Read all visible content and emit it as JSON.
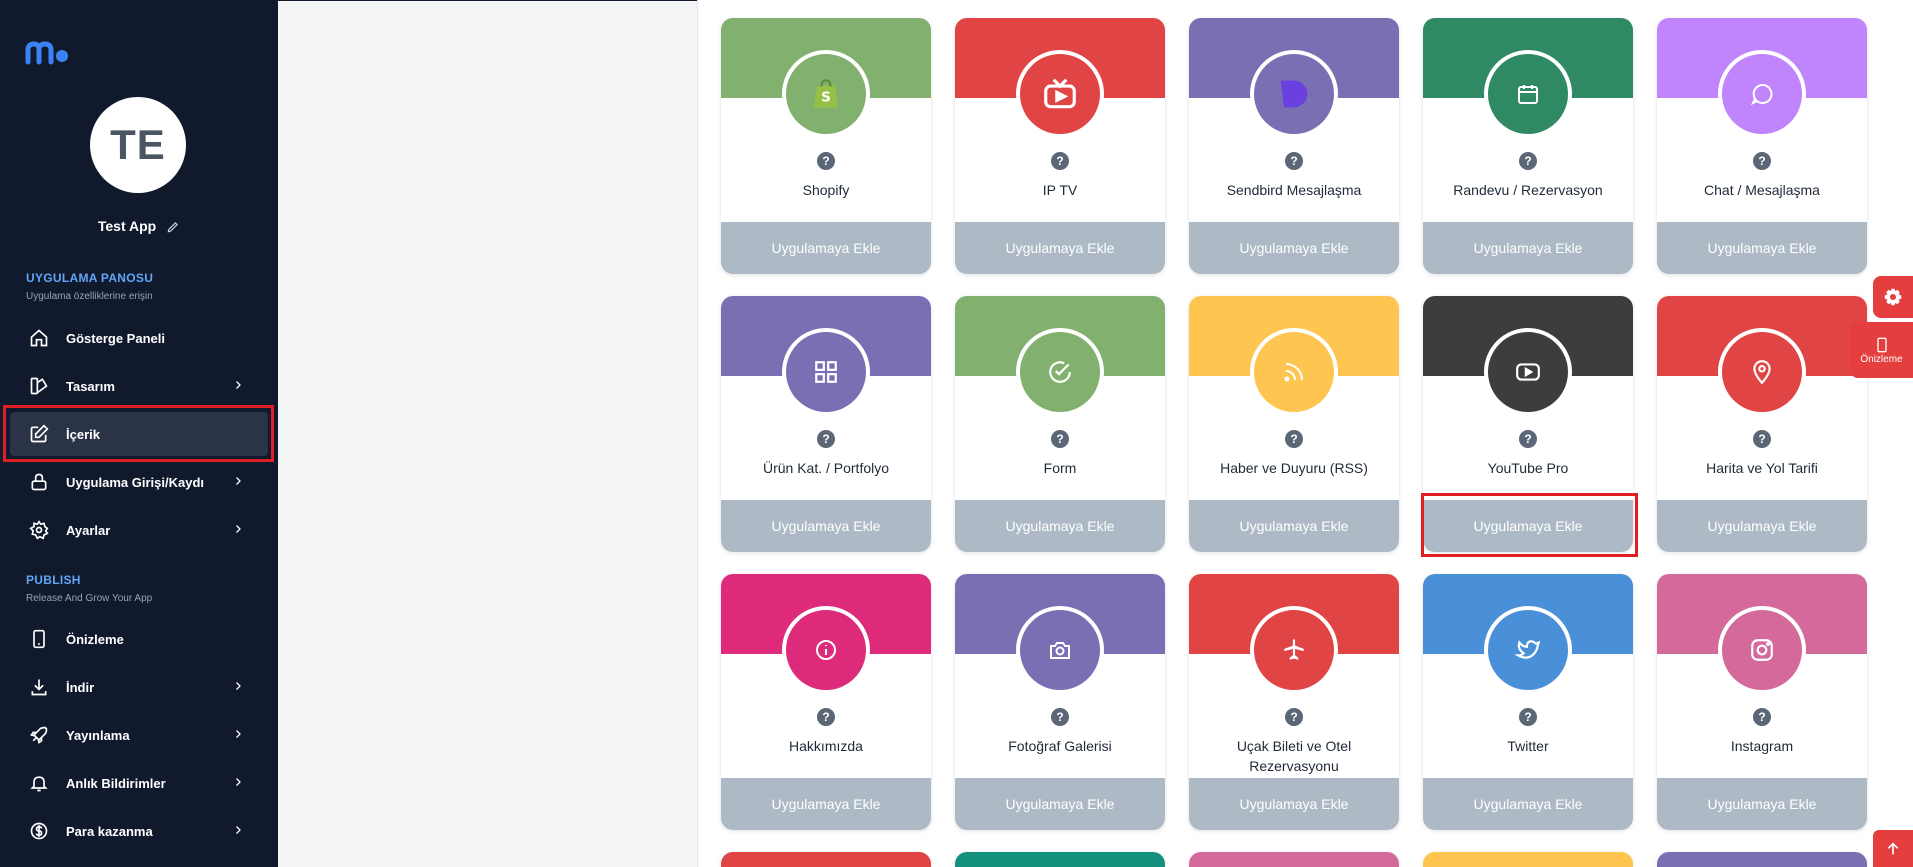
{
  "sidebar": {
    "avatar_initials": "TE",
    "app_name": "Test App",
    "section1": {
      "title": "UYGULAMA PANOSU",
      "subtitle": "Uygulama özelliklerine erişin"
    },
    "section2": {
      "title": "PUBLISH",
      "subtitle": "Release And Grow Your App"
    },
    "items": [
      {
        "label": "Gösterge Paneli",
        "icon": "home-icon",
        "chevron": false
      },
      {
        "label": "Tasarım",
        "icon": "design-icon",
        "chevron": true
      },
      {
        "label": "İçerik",
        "icon": "edit-icon",
        "chevron": false,
        "active": true
      },
      {
        "label": "Uygulama Girişi/Kaydı",
        "icon": "lock-icon",
        "chevron": true
      },
      {
        "label": "Ayarlar",
        "icon": "gear-icon",
        "chevron": true
      },
      {
        "label": "Önizleme",
        "icon": "phone-icon",
        "chevron": false
      },
      {
        "label": "İndir",
        "icon": "download-icon",
        "chevron": true
      },
      {
        "label": "Yayınlama",
        "icon": "rocket-icon",
        "chevron": true
      },
      {
        "label": "Anlık Bildirimler",
        "icon": "bell-icon",
        "chevron": true
      },
      {
        "label": "Para kazanma",
        "icon": "dollar-icon",
        "chevron": true
      }
    ]
  },
  "button_label": "Uygulamaya Ekle",
  "help_symbol": "?",
  "cards": [
    {
      "title": "Shopify",
      "color": "#82b06e",
      "icon": "shopify-icon"
    },
    {
      "title": "IP TV",
      "color": "#e04444",
      "icon": "tv-icon"
    },
    {
      "title": "Sendbird Mesajlaşma",
      "color": "#7b6fb4",
      "icon": "sendbird-icon"
    },
    {
      "title": "Randevu / Rezervasyon",
      "color": "#2f8a64",
      "icon": "calendar-icon"
    },
    {
      "title": "Chat / Mesajlaşma",
      "color": "#c084fc",
      "icon": "chat-icon"
    },
    {
      "title": "Ürün Kat. / Portfolyo",
      "color": "#7b6fb4",
      "icon": "grid-icon"
    },
    {
      "title": "Form",
      "color": "#82b06e",
      "icon": "check-icon"
    },
    {
      "title": "Haber ve Duyuru (RSS)",
      "color": "#fec651",
      "icon": "rss-icon"
    },
    {
      "title": "YouTube Pro",
      "color": "#3d3d3d",
      "icon": "youtube-icon"
    },
    {
      "title": "Harita ve Yol Tarifi",
      "color": "#e04444",
      "icon": "map-pin-icon"
    },
    {
      "title": "Hakkımızda",
      "color": "#dd2a7b",
      "icon": "info-icon"
    },
    {
      "title": "Fotoğraf Galerisi",
      "color": "#7b6fb4",
      "icon": "camera-icon"
    },
    {
      "title": "Uçak Bileti ve Otel Rezervasyonu",
      "color": "#e04444",
      "icon": "plane-icon"
    },
    {
      "title": "Twitter",
      "color": "#4a90d9",
      "icon": "twitter-icon"
    },
    {
      "title": "Instagram",
      "color": "#d4699c",
      "icon": "instagram-icon"
    }
  ],
  "partial_row_colors": [
    "#e04444",
    "#14917e",
    "#d4699c",
    "#fec651",
    "#7b6fb4"
  ],
  "float": {
    "preview_label": "Önizleme"
  }
}
